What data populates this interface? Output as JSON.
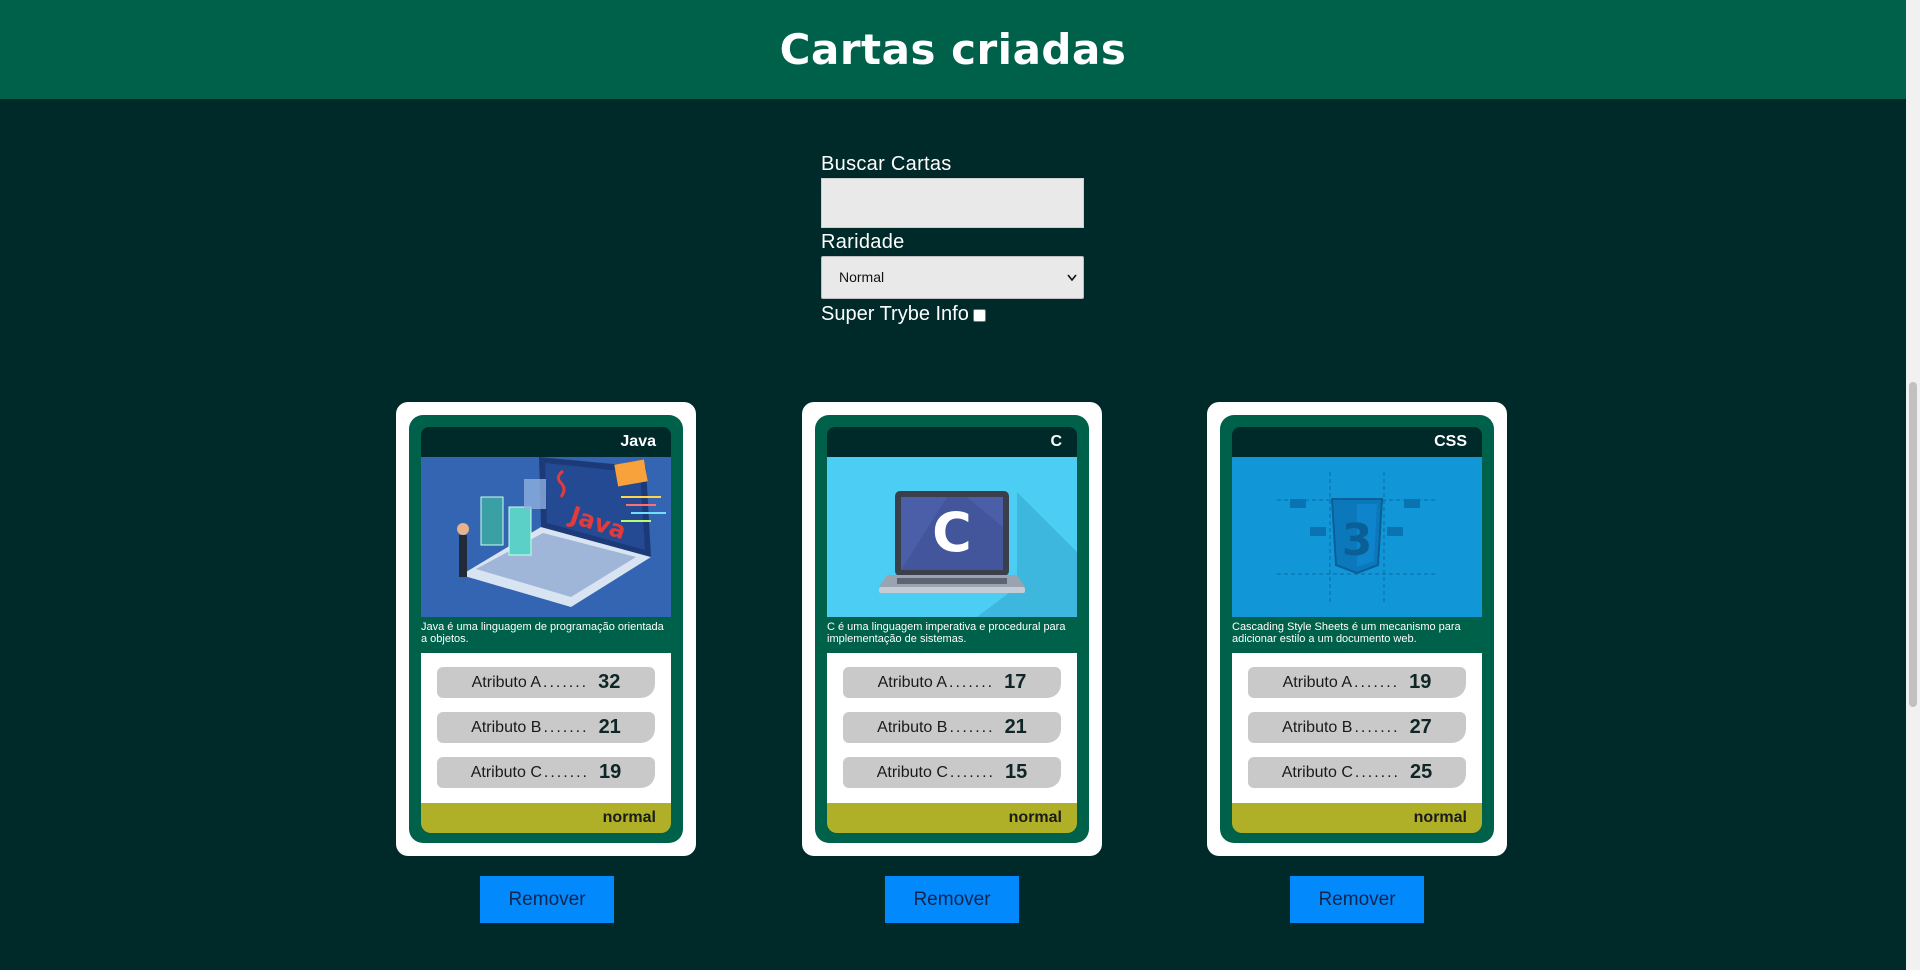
{
  "header": {
    "title": "Cartas criadas"
  },
  "filters": {
    "search_label": "Buscar Cartas",
    "search_value": "",
    "rarity_label": "Raridade",
    "rarity_selected": "Normal",
    "trunfo_label": "Super Trybe Info",
    "trunfo_checked": false
  },
  "cards": [
    {
      "name": "Java",
      "description": "Java é uma linguagem de programação orientada a objetos.",
      "attr1_label": "Atributo A",
      "attr1_value": "32",
      "attr2_label": "Atributo B",
      "attr2_value": "21",
      "attr3_label": "Atributo C",
      "attr3_value": "19",
      "rarity": "normal",
      "image_icon": "java-laptop-illustration",
      "remove_label": "Remover"
    },
    {
      "name": "C",
      "description": "C é uma linguagem imperativa e procedural para implementação de sistemas.",
      "attr1_label": "Atributo A",
      "attr1_value": "17",
      "attr2_label": "Atributo B",
      "attr2_value": "21",
      "attr3_label": "Atributo C",
      "attr3_value": "15",
      "rarity": "normal",
      "image_icon": "c-language-laptop-illustration",
      "remove_label": "Remover"
    },
    {
      "name": "CSS",
      "description": "Cascading Style Sheets é um mecanismo para adicionar estilo a um documento web.",
      "attr1_label": "Atributo A",
      "attr1_value": "19",
      "attr2_label": "Atributo B",
      "attr2_value": "27",
      "attr3_label": "Atributo C",
      "attr3_value": "25",
      "rarity": "normal",
      "image_icon": "css3-shield-illustration",
      "remove_label": "Remover"
    }
  ],
  "colors": {
    "background": "#002a2a",
    "header": "#00614a",
    "card_inner": "#00614a",
    "rarity_bar": "#afb028",
    "remove_button": "#0289fb"
  }
}
